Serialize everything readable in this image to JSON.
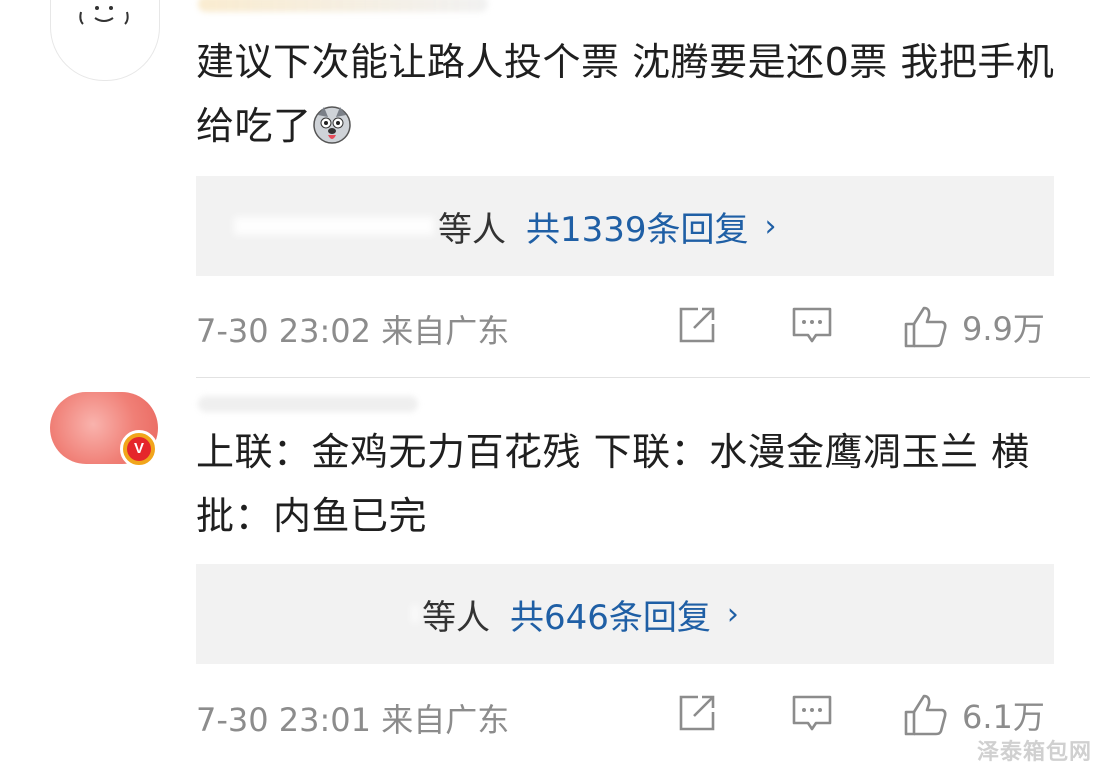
{
  "comments": [
    {
      "text": "建议下次能让路人投个票 沈腾要是还0票 我把手机给吃了",
      "emoji": "husky-emoji",
      "replies": {
        "names_suffix": "等人",
        "count_label": "共1339条回复",
        "chevron": "›"
      },
      "meta": "7-30 23:02 来自广东",
      "like_count": "9.9万",
      "icons": [
        "share-icon",
        "comment-icon",
        "like-icon"
      ]
    },
    {
      "text": "上联：金鸡无力百花残 下联：水漫金鹰凋玉兰 横批：内鱼已完",
      "badge": "V",
      "replies": {
        "names_suffix": "等人",
        "count_label": "共646条回复",
        "chevron": "›"
      },
      "meta": "7-30 23:01 来自广东",
      "like_count": "6.1万",
      "icons": [
        "share-icon",
        "comment-icon",
        "like-icon"
      ]
    }
  ],
  "watermark": "泽泰箱包网",
  "colors": {
    "link": "#1f5fa5",
    "meta": "#8c8c8c",
    "reply_bg": "#f2f2f2",
    "vip_badge": "#e5262b"
  }
}
